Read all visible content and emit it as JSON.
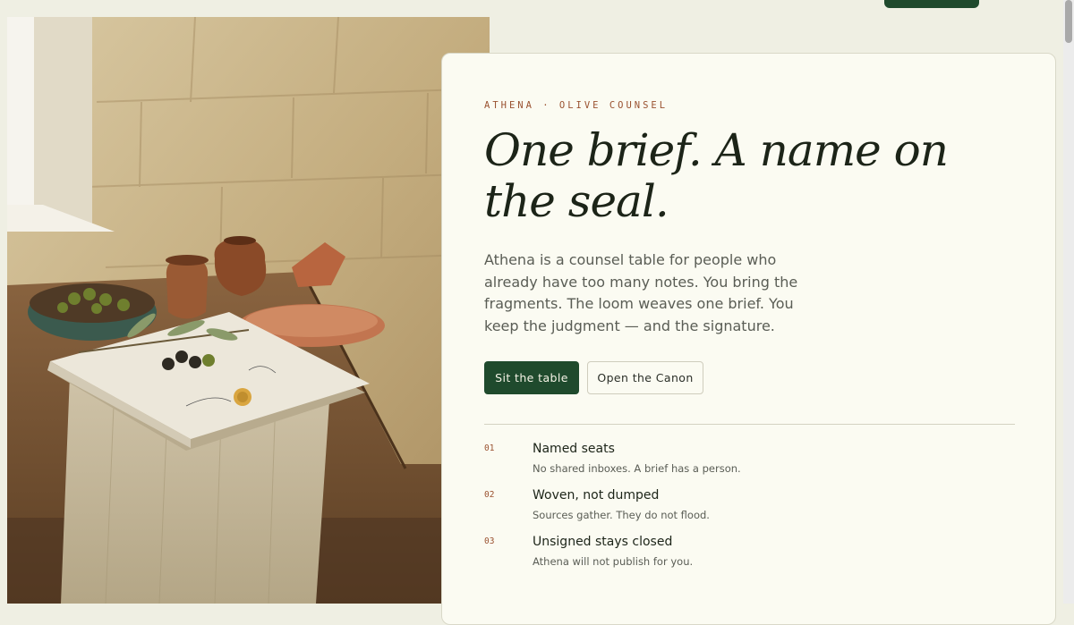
{
  "hero": {
    "eyebrow": "ATHENA · OLIVE COUNSEL",
    "headline": "One brief. A name on the seal.",
    "lede": "Athena is a counsel table for people who already have too many notes. You bring the fragments. The loom weaves one brief. You keep the judgment — and the signature.",
    "primary_cta": "Sit the table",
    "secondary_cta": "Open the Canon"
  },
  "features": [
    {
      "num": "01",
      "title": "Named seats",
      "desc": "No shared inboxes. A brief has a person."
    },
    {
      "num": "02",
      "title": "Woven, not dumped",
      "desc": "Sources gather. They do not flood."
    },
    {
      "num": "03",
      "title": "Unsigned stays closed",
      "desc": "Athena will not publish for you."
    }
  ],
  "colors": {
    "accent": "#1f4a2d",
    "eyebrow": "#9a5230",
    "background": "#efefe3",
    "card": "#fbfbf2"
  }
}
